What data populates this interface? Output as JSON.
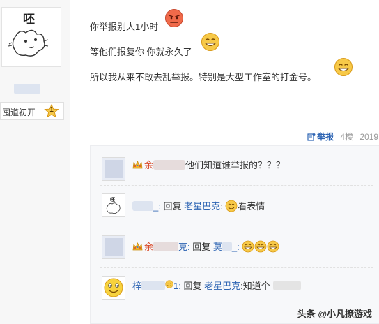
{
  "user": {
    "avatar_text": "呸",
    "level_name": "囤道初开",
    "level_num": "1"
  },
  "post": {
    "lines": [
      "你举报别人1小时",
      "等他们报复你 你就永久了",
      "所以我从来不敢去乱举报。特别是大型工作室的打金号。"
    ],
    "report_label": "举报",
    "floor": "4楼",
    "date": "2019"
  },
  "replies": [
    {
      "prefix_char": "余",
      "text": "他们知道谁举报的？？？"
    },
    {
      "name_suffix": "_: ",
      "action": "回复 ",
      "target": "老星巴克",
      "target_suffix": ": ",
      "text": "看表情"
    },
    {
      "prefix_char": "余",
      "name_suffix": "克: ",
      "action": "回复 ",
      "target": "莫",
      "target_suffix": "_: "
    },
    {
      "prefix_char": "梓",
      "name_suffix": "1: ",
      "action": "回复 ",
      "target": "老星巴克",
      "text": ":知道个"
    }
  ],
  "watermark": "头条 @小凡撩游戏",
  "colors": {
    "link": "#2d64b3",
    "panel_bg": "#f7f8fa",
    "emoji": "#f7c948"
  }
}
